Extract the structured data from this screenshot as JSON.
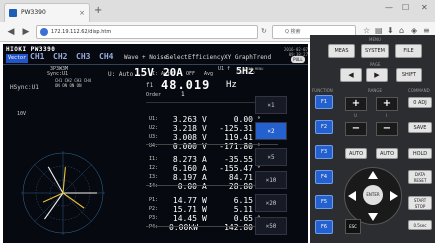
{
  "browser": {
    "tab_title": "PW3390",
    "new_tab": "+",
    "win_min": "—",
    "win_max": "☐",
    "win_close": "✕",
    "back": "◀",
    "forward": "▶",
    "url": "172.19.112.62/disp.htm",
    "reload": "↻",
    "search_placeholder": "Q 検索"
  },
  "instrument": {
    "logo": "HIOKI PW3390",
    "vector_tab": "Vector",
    "channels": [
      "CH1",
      "CH2",
      "CH3",
      "CH4"
    ],
    "menus": [
      "Wave + Noise",
      "Select",
      "Efficiency",
      "XY Graph",
      "Trend"
    ],
    "date": "2016-02-07 09:38:27",
    "pll": "PULL",
    "upd": "HSync:U1",
    "wiring": "3P3W3M",
    "sync": "Sync:U1",
    "ch_states": "CH1 CH2 CH3 CH4",
    "ch_on": "ON ON ON ON",
    "u_label": "U: Auto",
    "v_range": "15V",
    "i_label": "I: Auto",
    "i_range": "20A",
    "i_suffix": "OFF",
    "a_label": "Avg",
    "f_source": "U1 f",
    "f_value": "5Hz",
    "f_label": "f1:",
    "freq_label": "f1",
    "freq": "48.019",
    "freq_unit": "Hz",
    "order_label": "Order",
    "order_value": "1",
    "scale_label": "10V",
    "status_lines": [
      "ST ROKED MENU",
      "1 U1 ON 2"
    ],
    "zoom_buttons": [
      "×1",
      "×2",
      "×5",
      "×10",
      "×20",
      "×50"
    ],
    "rows": [
      {
        "lb": "U1:",
        "v1": "3.263",
        "u1": "V",
        "v2": "0.00",
        "u2": "°"
      },
      {
        "lb": "U2:",
        "v1": "3.218",
        "u1": "V",
        "v2": "-125.31",
        "u2": "°"
      },
      {
        "lb": "U3:",
        "v1": "3.008",
        "u1": "V",
        "v2": "119.41",
        "u2": "°"
      },
      {
        "lb": "U4:",
        "v1": "0.000",
        "u1": "V",
        "v2": "-171.80",
        "u2": "°"
      },
      {
        "lb": "I1:",
        "v1": "8.273",
        "u1": "A",
        "v2": "-35.55",
        "u2": "°"
      },
      {
        "lb": "I2:",
        "v1": "6.160",
        "u1": "A",
        "v2": "-155.47",
        "u2": "°"
      },
      {
        "lb": "I3:",
        "v1": "8.197",
        "u1": "A",
        "v2": "84.71",
        "u2": "°"
      },
      {
        "lb": "I4:",
        "v1": "0.00",
        "u1": "A",
        "v2": "28.80",
        "u2": "°"
      },
      {
        "lb": "P1:",
        "v1": "14.77",
        "u1": "W",
        "v2": "6.15",
        "u2": "°"
      },
      {
        "lb": "P2:",
        "v1": "15.71",
        "u1": "W",
        "v2": "5.11",
        "u2": "°"
      },
      {
        "lb": "P3:",
        "v1": "14.45",
        "u1": "W",
        "v2": "0.65",
        "u2": "°"
      },
      {
        "lb": "P4:",
        "v1": "0.00kW",
        "u1": "",
        "v2": "142.80",
        "u2": "°"
      }
    ]
  },
  "panel": {
    "menu_label": "MENU",
    "meas": "MEAS",
    "system": "SYSTEM",
    "file": "FILE",
    "page_label": "PAGE",
    "page_prev": "◀",
    "page_next": "▶",
    "shift": "SHIFT",
    "function_label": "FUNCTION",
    "range_label": "RANGE",
    "command_label": "COMMAND",
    "f_keys": [
      "F1",
      "F2",
      "F3",
      "F4",
      "F5",
      "F6"
    ],
    "plus": "+",
    "minus": "−",
    "u_label": "U",
    "i_label": "I",
    "auto": "AUTO",
    "zero_adj": "0 ADJ",
    "save": "SAVE",
    "hold": "HOLD",
    "data_reset": "DATA RESET",
    "start_stop": "START STOP",
    "enter": "ENTER",
    "esc": "ESC",
    "interval": "0.5sec"
  }
}
